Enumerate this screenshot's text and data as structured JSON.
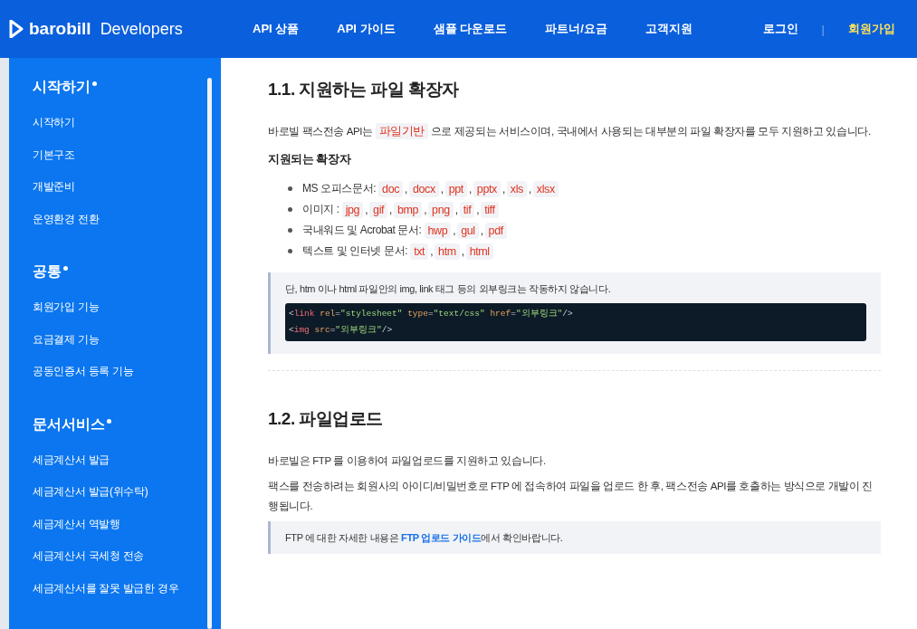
{
  "header": {
    "logo": "barobill",
    "logo_suffix": "Developers",
    "nav": [
      {
        "label": "API 상품"
      },
      {
        "label": "API 가이드"
      },
      {
        "label": "샘플 다운로드"
      },
      {
        "label": "파트너/요금"
      },
      {
        "label": "고객지원"
      }
    ],
    "account": [
      {
        "label": "로그인",
        "highlight": false
      },
      {
        "label": "|",
        "kind": "separator"
      },
      {
        "label": "회원가입",
        "highlight": true
      }
    ]
  },
  "sidebar": {
    "sections": [
      {
        "title": "시작하기",
        "items": [
          "시작하기",
          "기본구조",
          "개발준비",
          "운영환경 전환"
        ]
      },
      {
        "title": "공통",
        "items": [
          "회원가입 기능",
          "요금결제 기능",
          "공동인증서 등록 기능"
        ]
      },
      {
        "title": "문서서비스",
        "items": [
          "세금계산서 발급",
          "세금계산서 발급(위수탁)",
          "세금계산서 역발행",
          "세금계산서 국세청 전송",
          "세금계산서를 잘못 발급한 경우"
        ]
      }
    ]
  },
  "content": [
    {
      "kind": "heading",
      "text": "1.1. 지원하는 파일 확장자"
    },
    {
      "kind": "paragraph",
      "parts": [
        {
          "text": "바로빌 팩스전송 API는 "
        },
        {
          "code": "파일기반"
        },
        {
          "text": " 으로 제공되는 서비스이며, 국내에서 사용되는 대부분의 파일 확장자를 모두 지원하고 있습니다."
        }
      ]
    },
    {
      "kind": "subheading",
      "text": "지원되는 확장자"
    },
    {
      "kind": "list",
      "items": [
        {
          "label": "MS 오피스문서:",
          "codes": [
            "doc",
            ",",
            "docx",
            ",",
            "ppt",
            ",",
            "pptx",
            ",",
            "xls",
            ",",
            "xlsx"
          ]
        },
        {
          "label": "이미지 :",
          "codes": [
            "jpg",
            ",",
            "gif",
            ",",
            "bmp",
            ",",
            "png",
            ",",
            "tif",
            ",",
            "tiff"
          ]
        },
        {
          "label": "국내워드 및 Acrobat 문서:",
          "codes": [
            "hwp",
            ",",
            "gul",
            ",",
            "pdf"
          ]
        },
        {
          "label": "텍스트 및 인터넷 문서:",
          "codes": [
            "txt",
            ",",
            "htm",
            ",",
            "html"
          ]
        }
      ]
    },
    {
      "kind": "note",
      "parts": [
        {
          "text": "단, htm 이나 html 파일안의 img, link 태그 등의 외부링크는 작동하지 않습니다."
        }
      ],
      "code_lines": [
        [
          {
            "kind": "punct",
            "s": "<"
          },
          {
            "kind": "tag",
            "s": "link"
          },
          {
            "kind": "attr",
            "s": " rel"
          },
          {
            "kind": "punct",
            "s": "="
          },
          {
            "kind": "string",
            "s": "\"stylesheet\""
          },
          {
            "kind": "attr",
            "s": " type"
          },
          {
            "kind": "punct",
            "s": "="
          },
          {
            "kind": "string",
            "s": "\"text/css\""
          },
          {
            "kind": "attr",
            "s": " href"
          },
          {
            "kind": "punct",
            "s": "="
          },
          {
            "kind": "string",
            "s": "\"외부링크\""
          },
          {
            "kind": "punct",
            "s": "/>"
          }
        ],
        [
          {
            "kind": "punct",
            "s": "<"
          },
          {
            "kind": "tag",
            "s": "img"
          },
          {
            "kind": "attr",
            "s": " src"
          },
          {
            "kind": "punct",
            "s": "="
          },
          {
            "kind": "string",
            "s": "\"외부링크\""
          },
          {
            "kind": "punct",
            "s": "/>"
          }
        ]
      ]
    },
    {
      "kind": "divider"
    },
    {
      "kind": "heading",
      "text": "1.2. 파일업로드"
    },
    {
      "kind": "paragraph",
      "parts": [
        {
          "text": "바로빌은 FTP 를 이용하여 파일업로드를 지원하고 있습니다."
        }
      ]
    },
    {
      "kind": "paragraph",
      "parts": [
        {
          "text": "팩스를 전송하려는 회원사의 아이디/비밀번호로 FTP 에 접속하여 파일을 업로드 한 후, 팩스전송 API를 호출하는 방식으로 개발이 진행됩니다."
        }
      ]
    },
    {
      "kind": "note",
      "parts": [
        {
          "text": "FTP 에 대한 자세한 내용은 "
        },
        {
          "link": "FTP 업로드 가이드"
        },
        {
          "text": "에서 확인바랍니다."
        }
      ]
    }
  ]
}
